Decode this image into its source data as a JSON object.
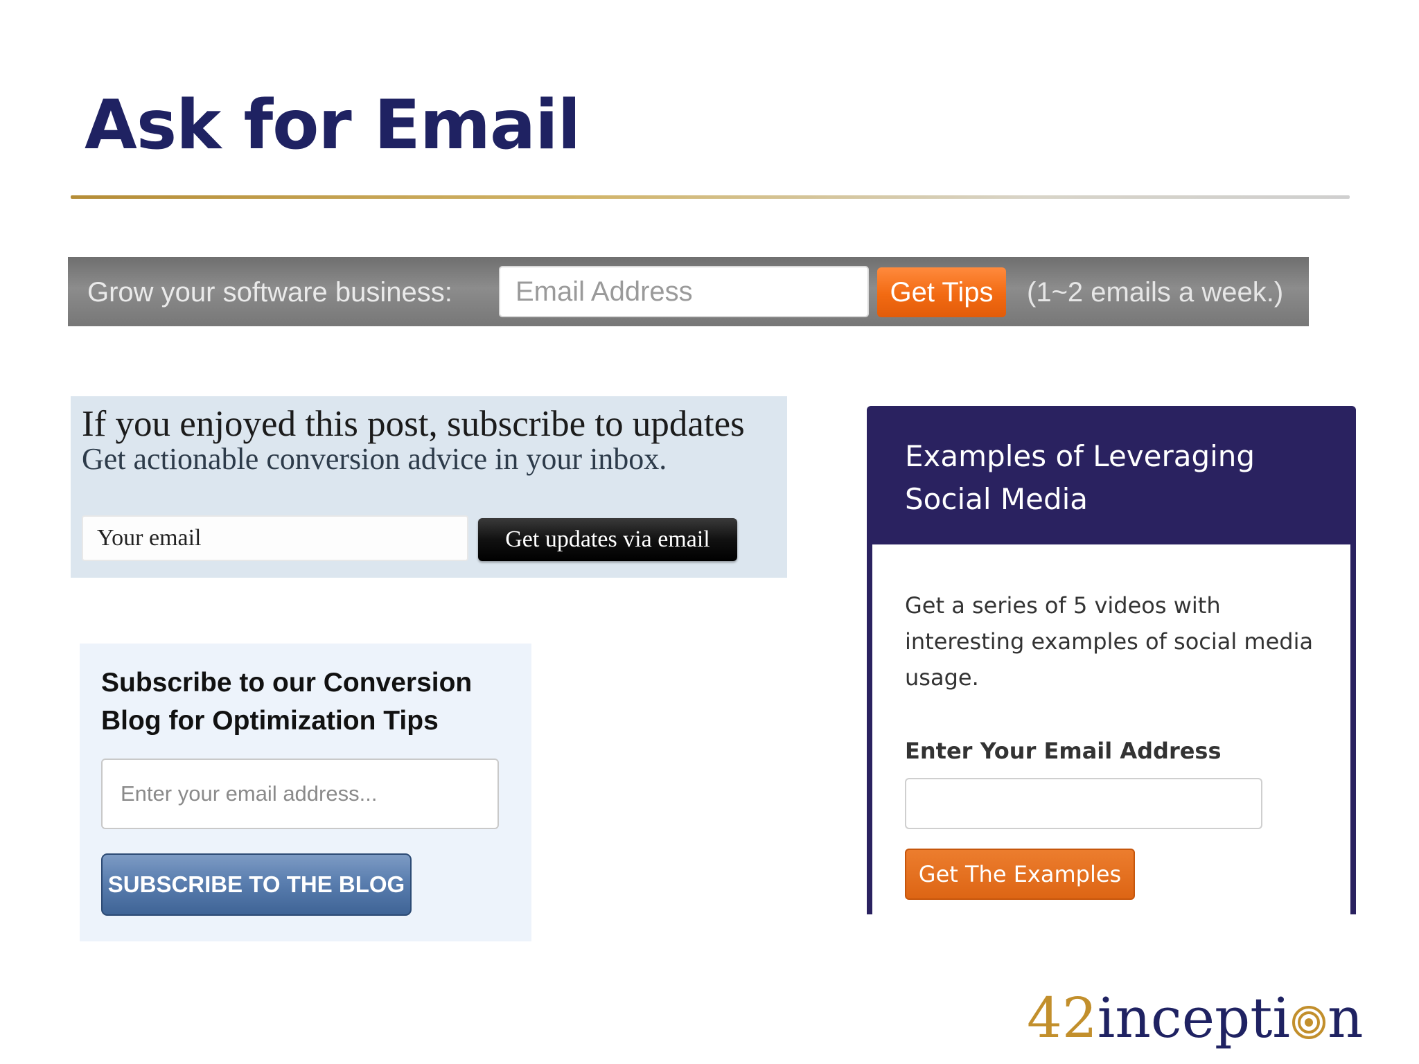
{
  "slide": {
    "title": "Ask for Email"
  },
  "widget_bar": {
    "label": "Grow your software business:",
    "email_placeholder": "Email Address",
    "button_label": "Get Tips",
    "note": "(1~2 emails a week.)"
  },
  "widget_post": {
    "heading": "If you enjoyed this post, subscribe to updates",
    "subheading": "Get actionable conversion advice in your inbox.",
    "email_placeholder": "Your email",
    "button_label": "Get updates via email"
  },
  "widget_blog": {
    "heading": "Subscribe to our Conversion Blog for Optimization Tips",
    "email_placeholder": "Enter your email address...",
    "button_label": "SUBSCRIBE TO THE BLOG"
  },
  "widget_social": {
    "title": "Examples of Leveraging Social Media",
    "description": "Get a series of 5 videos with interesting examples of social media usage.",
    "field_label": "Enter Your Email Address",
    "email_value": "",
    "button_label": "Get The Examples"
  },
  "logo": {
    "number": "42",
    "word_start": "incepti",
    "word_end": "n",
    "icon": "target-icon"
  },
  "colors": {
    "title": "#1f2262",
    "card_header": "#2a2260",
    "orange_button": "#f26a12",
    "logo_gold": "#c28f2c"
  }
}
